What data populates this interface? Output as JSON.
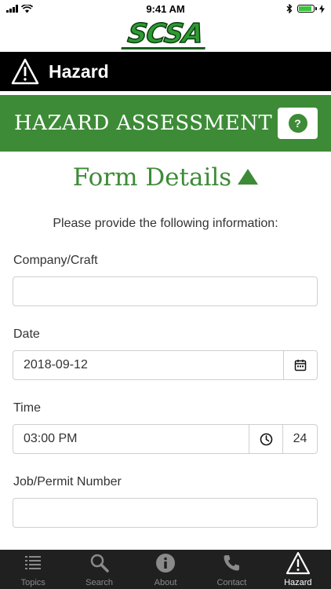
{
  "status": {
    "time": "9:41 AM",
    "battery_fill": 0.9
  },
  "logo": {
    "text": "SCSA"
  },
  "header": {
    "title": "Hazard"
  },
  "section": {
    "title": "HAZARD ASSESSMENT",
    "help_label": "?"
  },
  "form": {
    "title": "Form Details",
    "instructions": "Please provide the following information:",
    "company": {
      "label": "Company/Craft",
      "value": ""
    },
    "date": {
      "label": "Date",
      "value": "2018-09-12"
    },
    "time": {
      "label": "Time",
      "value": "03:00 PM",
      "format_label": "24"
    },
    "job": {
      "label": "Job/Permit Number",
      "value": ""
    }
  },
  "tabs": [
    {
      "label": "Topics",
      "icon": "list-icon",
      "active": false
    },
    {
      "label": "Search",
      "icon": "search-icon",
      "active": false
    },
    {
      "label": "About",
      "icon": "info-icon",
      "active": false
    },
    {
      "label": "Contact",
      "icon": "phone-icon",
      "active": false
    },
    {
      "label": "Hazard",
      "icon": "warning-icon",
      "active": true
    }
  ],
  "colors": {
    "brand_green": "#3d8b37",
    "header_black": "#000000",
    "tabbar": "#202020"
  }
}
